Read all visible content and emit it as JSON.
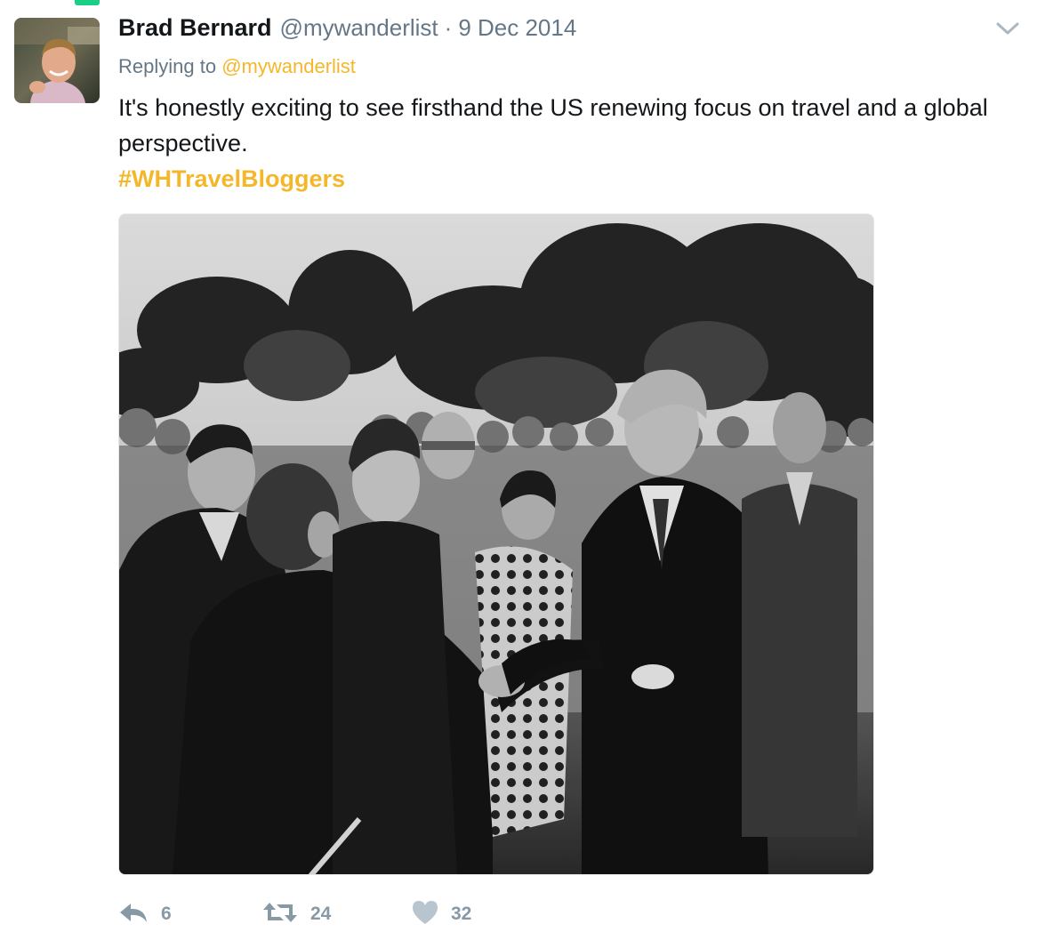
{
  "tweet": {
    "author_name": "Brad Bernard",
    "author_handle": "@mywanderlist",
    "separator": "·",
    "date": "9 Dec 2014",
    "replying_prefix": "Replying to",
    "replying_handle": "@mywanderlist",
    "text": "It's honestly exciting to see firsthand the US renewing focus on travel and a global perspective.",
    "hashtag": "#WHTravelBloggers"
  },
  "actions": {
    "reply_count": "6",
    "retweet_count": "24",
    "like_count": "32"
  },
  "icons": {
    "menu": "chevron-down-icon",
    "reply": "reply-icon",
    "retweet": "retweet-icon",
    "like": "heart-icon"
  },
  "colors": {
    "link": "#f5b72a",
    "muted": "#657786",
    "action": "#8899a6",
    "text": "#14171a"
  }
}
